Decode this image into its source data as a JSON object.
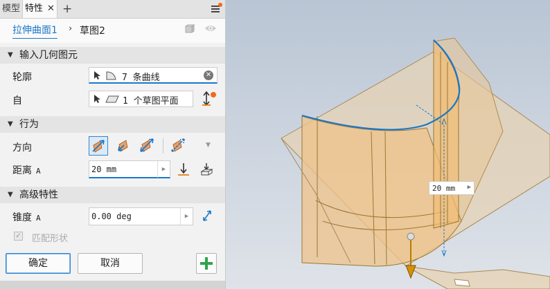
{
  "tabs": [
    {
      "label": "模型",
      "active": false
    },
    {
      "label": "特性",
      "active": true
    }
  ],
  "tab_close": "✕",
  "tab_add": "+",
  "breadcrumb": {
    "feature": "拉伸曲面1",
    "separator": "›",
    "sketch": "草图2"
  },
  "sections": {
    "input_geometry": "输入几何图元",
    "behavior": "行为",
    "advanced": "高级特性"
  },
  "profile": {
    "label": "轮廓",
    "value": "7 条曲线"
  },
  "from": {
    "label": "自",
    "value": "1 个草图平面"
  },
  "direction": {
    "label": "方向"
  },
  "distance": {
    "label": "距离",
    "suffix": "A",
    "value": "20 mm"
  },
  "taper": {
    "label": "锥度",
    "suffix": "A",
    "value": "0.00 deg"
  },
  "match_shape": {
    "label": "匹配形状",
    "checked": true
  },
  "buttons": {
    "ok": "确定",
    "cancel": "取消"
  },
  "viewport": {
    "dimension_value": "20 mm"
  },
  "colors": {
    "accent": "#1a77c8",
    "notify_dot": "#f06a1d",
    "add_green": "#2ea44f",
    "surface": "#f0c98c"
  },
  "icons": [
    "menu-icon",
    "cube-icon",
    "eye-icon",
    "cursor-icon",
    "curve-icon",
    "plane-icon",
    "clear-icon",
    "flip-icon",
    "direction-icon",
    "measure-icon",
    "add-icon"
  ]
}
